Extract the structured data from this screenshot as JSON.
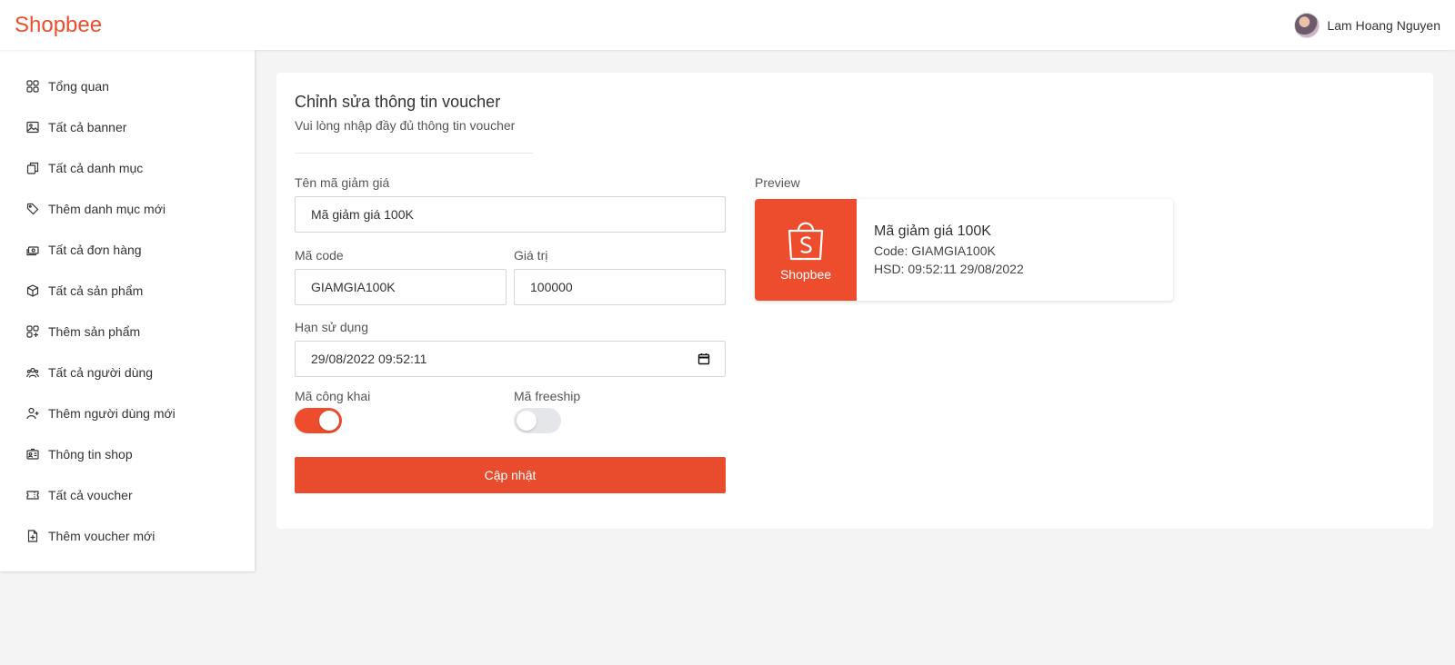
{
  "header": {
    "brand": "Shopbee",
    "user_name": "Lam Hoang Nguyen"
  },
  "sidebar": {
    "items": [
      {
        "label": "Tổng quan",
        "icon": "grid-icon"
      },
      {
        "label": "Tất cả banner",
        "icon": "image-icon"
      },
      {
        "label": "Tất cả danh mục",
        "icon": "copy-icon"
      },
      {
        "label": "Thêm danh mục mới",
        "icon": "tag-icon"
      },
      {
        "label": "Tất cả đơn hàng",
        "icon": "cash-icon"
      },
      {
        "label": "Tất cả sản phẩm",
        "icon": "box-icon"
      },
      {
        "label": "Thêm sản phẩm",
        "icon": "grid-plus-icon"
      },
      {
        "label": "Tất cả người dùng",
        "icon": "users-icon"
      },
      {
        "label": "Thêm người dùng mới",
        "icon": "user-plus-icon"
      },
      {
        "label": "Thông tin shop",
        "icon": "id-card-icon"
      },
      {
        "label": "Tất cả voucher",
        "icon": "ticket-icon"
      },
      {
        "label": "Thêm voucher mới",
        "icon": "file-plus-icon"
      }
    ]
  },
  "form": {
    "title": "Chỉnh sửa thông tin voucher",
    "subtitle": "Vui lòng nhập đầy đủ thông tin voucher",
    "name_label": "Tên mã giảm giá",
    "name_value": "Mã giảm giá 100K",
    "code_label": "Mã code",
    "code_value": "GIAMGIA100K",
    "value_label": "Giá trị",
    "value_value": "100000",
    "expiry_label": "Hạn sử dụng",
    "expiry_value": "29/08/2022 09:52:11",
    "public_label": "Mã công khai",
    "public_on": true,
    "freeship_label": "Mã freeship",
    "freeship_on": false,
    "submit_label": "Cập nhật"
  },
  "preview": {
    "label": "Preview",
    "brand": "Shopbee",
    "title": "Mã giảm giá 100K",
    "code_line": "Code: GIAMGIA100K",
    "expiry_line": "HSD: 09:52:11 29/08/2022"
  },
  "colors": {
    "accent": "#ee4d2d",
    "background": "#f4f4f4"
  }
}
